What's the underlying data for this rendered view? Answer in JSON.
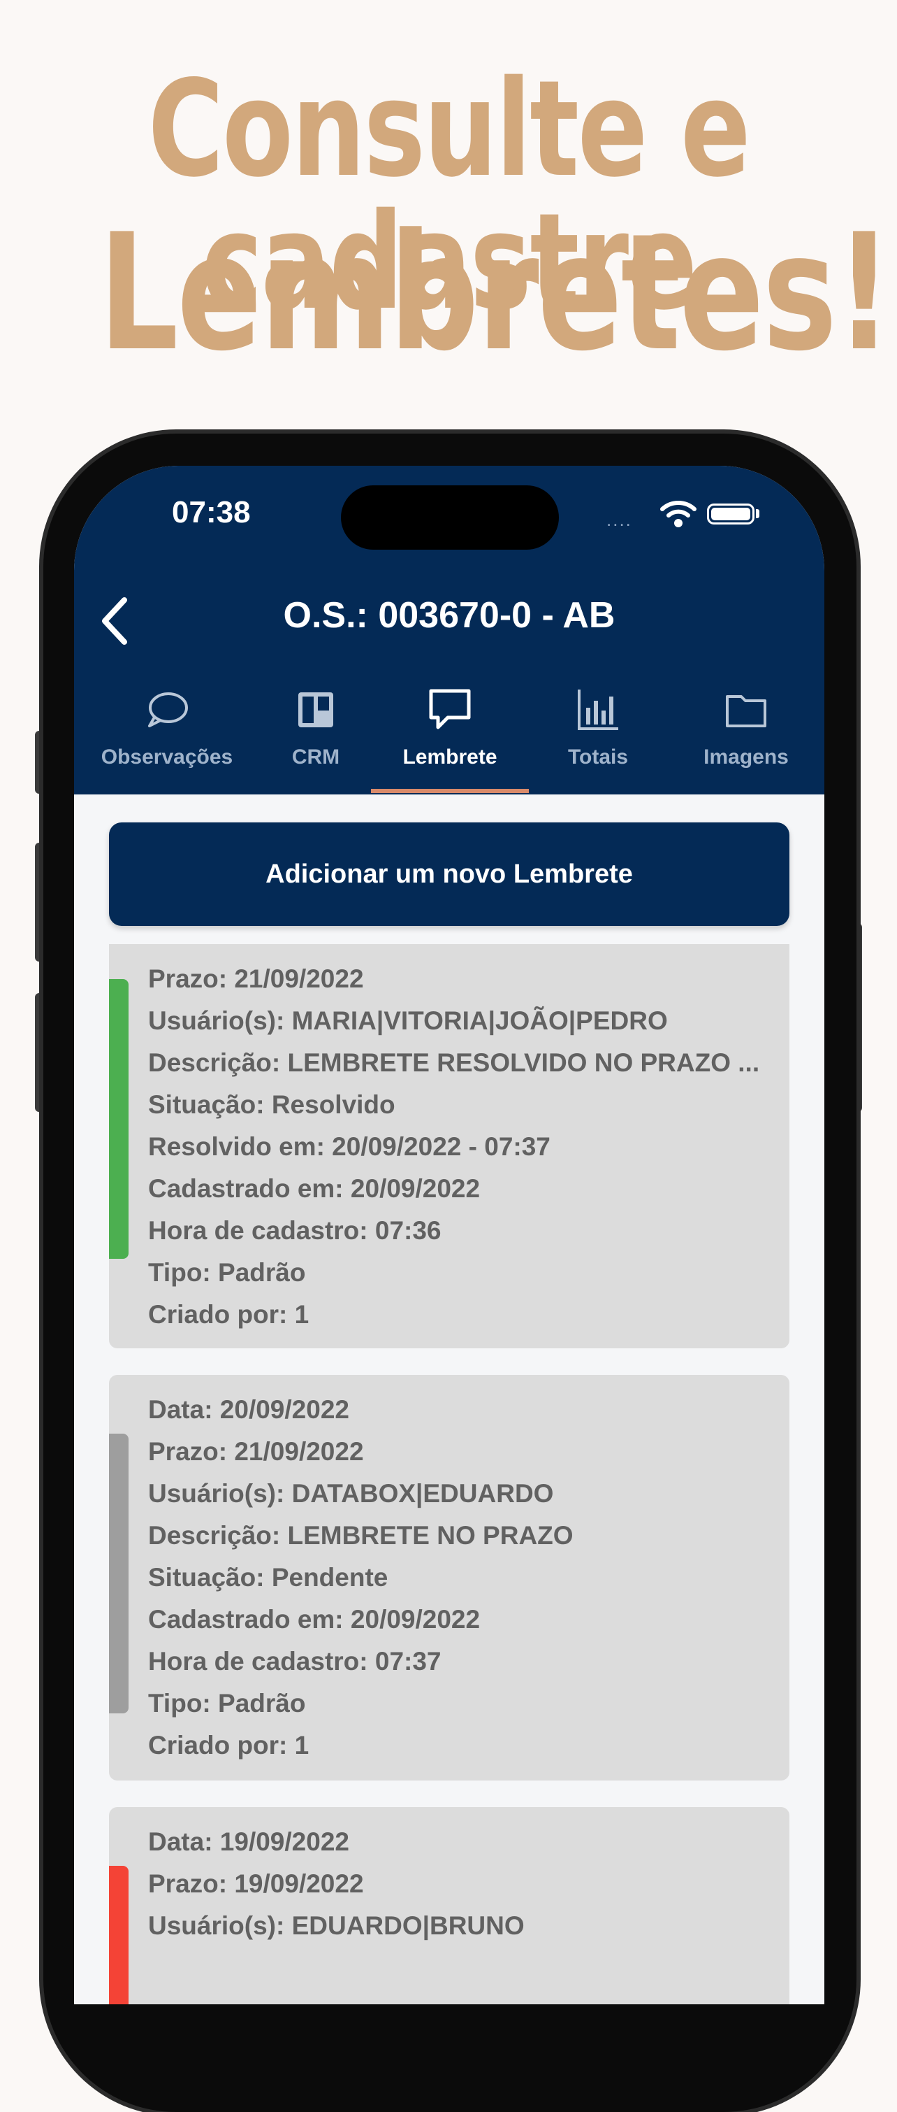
{
  "promo": {
    "line1": "Consulte e cadastre",
    "line2": "Lembretes!"
  },
  "status_bar": {
    "time": "07:38",
    "signal": "....",
    "icons": [
      "wifi-icon",
      "battery-icon"
    ]
  },
  "header": {
    "back_icon": "chevron-left-icon",
    "title": "O.S.: 003670-0 - AB"
  },
  "tabs": [
    {
      "label": "Observações",
      "icon": "speech-bubble-icon"
    },
    {
      "label": "CRM",
      "icon": "kanban-board-icon"
    },
    {
      "label": "Lembrete",
      "icon": "message-square-icon",
      "active": true
    },
    {
      "label": "Totais",
      "icon": "bar-chart-icon"
    },
    {
      "label": "Imagens",
      "icon": "folder-icon"
    }
  ],
  "add_button": {
    "label": "Adicionar um novo Lembrete"
  },
  "colors": {
    "brand": "#042a56",
    "tab_indicator": "#d98a6a",
    "resolved": "#4caf50",
    "pending": "#9e9e9e",
    "overdue": "#f44336",
    "headline": "#d2a87c"
  },
  "reminders": [
    {
      "status_color": "#4caf50",
      "lines": [
        "Prazo: 21/09/2022",
        "Usuário(s): MARIA|VITORIA|JOÃO|PEDRO",
        "Descrição: LEMBRETE RESOLVIDO NO PRAZO ...",
        "Situação: Resolvido",
        "Resolvido em: 20/09/2022 - 07:37",
        "Cadastrado em: 20/09/2022",
        "Hora de cadastro: 07:36",
        "Tipo: Padrão",
        "Criado por: 1"
      ]
    },
    {
      "status_color": "#9e9e9e",
      "lines": [
        "Data: 20/09/2022",
        "Prazo: 21/09/2022",
        "Usuário(s): DATABOX|EDUARDO",
        "Descrição: LEMBRETE NO PRAZO",
        "Situação: Pendente",
        "Cadastrado em: 20/09/2022",
        "Hora de cadastro: 07:37",
        "Tipo: Padrão",
        "Criado por: 1"
      ]
    },
    {
      "status_color": "#f44336",
      "lines": [
        "Data: 19/09/2022",
        "Prazo: 19/09/2022",
        "Usuário(s): EDUARDO|BRUNO"
      ]
    }
  ]
}
